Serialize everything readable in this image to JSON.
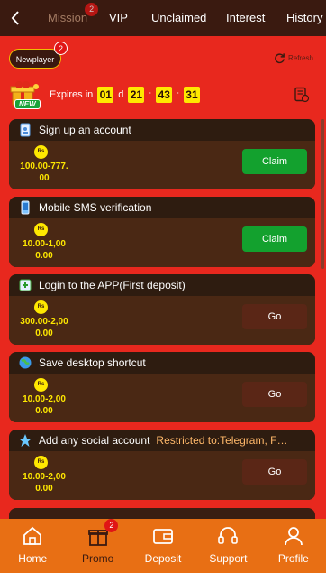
{
  "header": {
    "tabs": [
      {
        "label": "Mission",
        "badge": "2",
        "active": true
      },
      {
        "label": "VIP"
      },
      {
        "label": "Unclaimed"
      },
      {
        "label": "Interest"
      },
      {
        "label": "History"
      }
    ]
  },
  "newplayer": {
    "label": "Newplayer",
    "badge": "2"
  },
  "refresh_label": "Refresh",
  "new_tag": "NEW",
  "expires": {
    "label": "Expires in",
    "days": "01",
    "day_unit": "d",
    "hours": "21",
    "minutes": "43",
    "seconds": "31",
    "sep": ":"
  },
  "coin_label": "Rs",
  "tasks": [
    {
      "title": "Sign up an account",
      "restricted": "",
      "amount_line1": "100.00-777.",
      "amount_line2": "00",
      "button": "Claim",
      "icon": "phone-user-icon"
    },
    {
      "title": "Mobile SMS verification",
      "restricted": "",
      "amount_line1": "10.00-1,00",
      "amount_line2": "0.00",
      "button": "Claim",
      "icon": "mobile-sms-icon"
    },
    {
      "title": "Login to the APP(First deposit)",
      "restricted": "",
      "amount_line1": "300.00-2,00",
      "amount_line2": "0.00",
      "button": "Go",
      "icon": "app-login-icon"
    },
    {
      "title": "Save desktop shortcut",
      "restricted": "",
      "amount_line1": "10.00-2,00",
      "amount_line2": "0.00",
      "button": "Go",
      "icon": "globe-icon"
    },
    {
      "title": "Add any social account",
      "restricted": "Restricted to:Telegram, F…",
      "amount_line1": "10.00-2,00",
      "amount_line2": "0.00",
      "button": "Go",
      "icon": "social-icon"
    }
  ],
  "bottom_nav": [
    {
      "label": "Home",
      "icon": "home-icon"
    },
    {
      "label": "Promo",
      "icon": "gift-icon",
      "badge": "2",
      "active": true
    },
    {
      "label": "Deposit",
      "icon": "wallet-icon"
    },
    {
      "label": "Support",
      "icon": "headset-icon"
    },
    {
      "label": "Profile",
      "icon": "user-icon"
    }
  ],
  "colors": {
    "background": "#e8281e",
    "claim": "#13a12e",
    "go": "#5a2616",
    "amount": "#ffe800",
    "bottom_nav": "#e86f14"
  }
}
